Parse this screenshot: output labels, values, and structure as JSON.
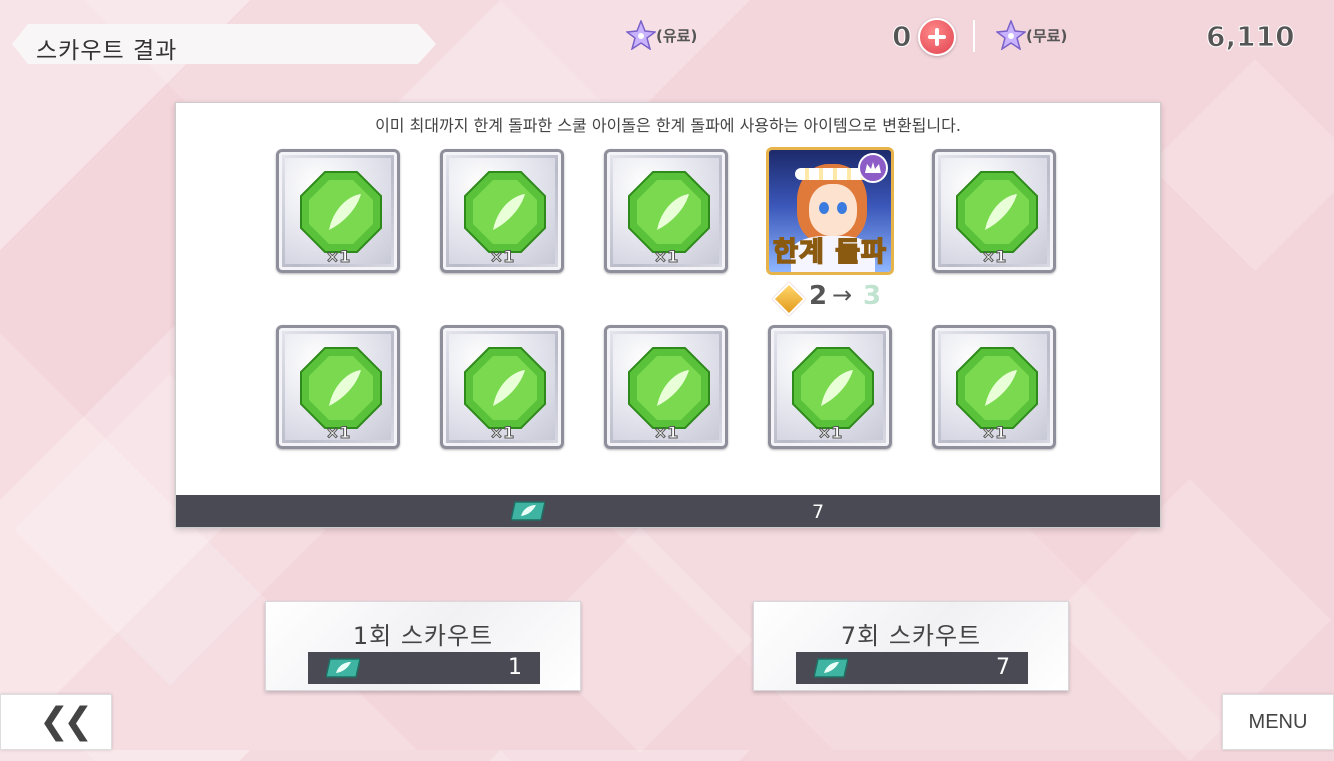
{
  "header": {
    "title": "스카우트 결과",
    "paid_currency_label": "(유료)",
    "paid_currency_count": "0",
    "free_currency_label": "(무료)",
    "free_currency_count": "6,110"
  },
  "panel": {
    "notice": "이미 최대까지 한계 돌파한 스쿨 아이돌은 한계 돌파에 사용하는 아이템으로 변환됩니다.",
    "items": [
      {
        "type": "gem",
        "qty": "×1"
      },
      {
        "type": "gem",
        "qty": "×1"
      },
      {
        "type": "gem",
        "qty": "×1"
      },
      {
        "type": "card",
        "overlay_text": "한계 돌파",
        "limit_from": "2",
        "arrow": "→",
        "limit_to": "3"
      },
      {
        "type": "gem",
        "qty": "×1"
      },
      {
        "type": "gem",
        "qty": "×1"
      },
      {
        "type": "gem",
        "qty": "×1"
      },
      {
        "type": "gem",
        "qty": "×1"
      },
      {
        "type": "gem",
        "qty": "×1"
      },
      {
        "type": "gem",
        "qty": "×1"
      }
    ],
    "ticket_count": "7"
  },
  "buttons": {
    "scout_single": {
      "label": "1회 스카우트",
      "cost": "1"
    },
    "scout_multi": {
      "label": "7회 스카우트",
      "cost": "7"
    },
    "back_label": "❮❮",
    "menu_label": "MENU"
  },
  "colors": {
    "background": "#f3d6dc",
    "gem": "#59c23a",
    "dark_bar": "#4a4a55",
    "accent_red": "#e0414f",
    "card_frame": "#e7b44b"
  }
}
